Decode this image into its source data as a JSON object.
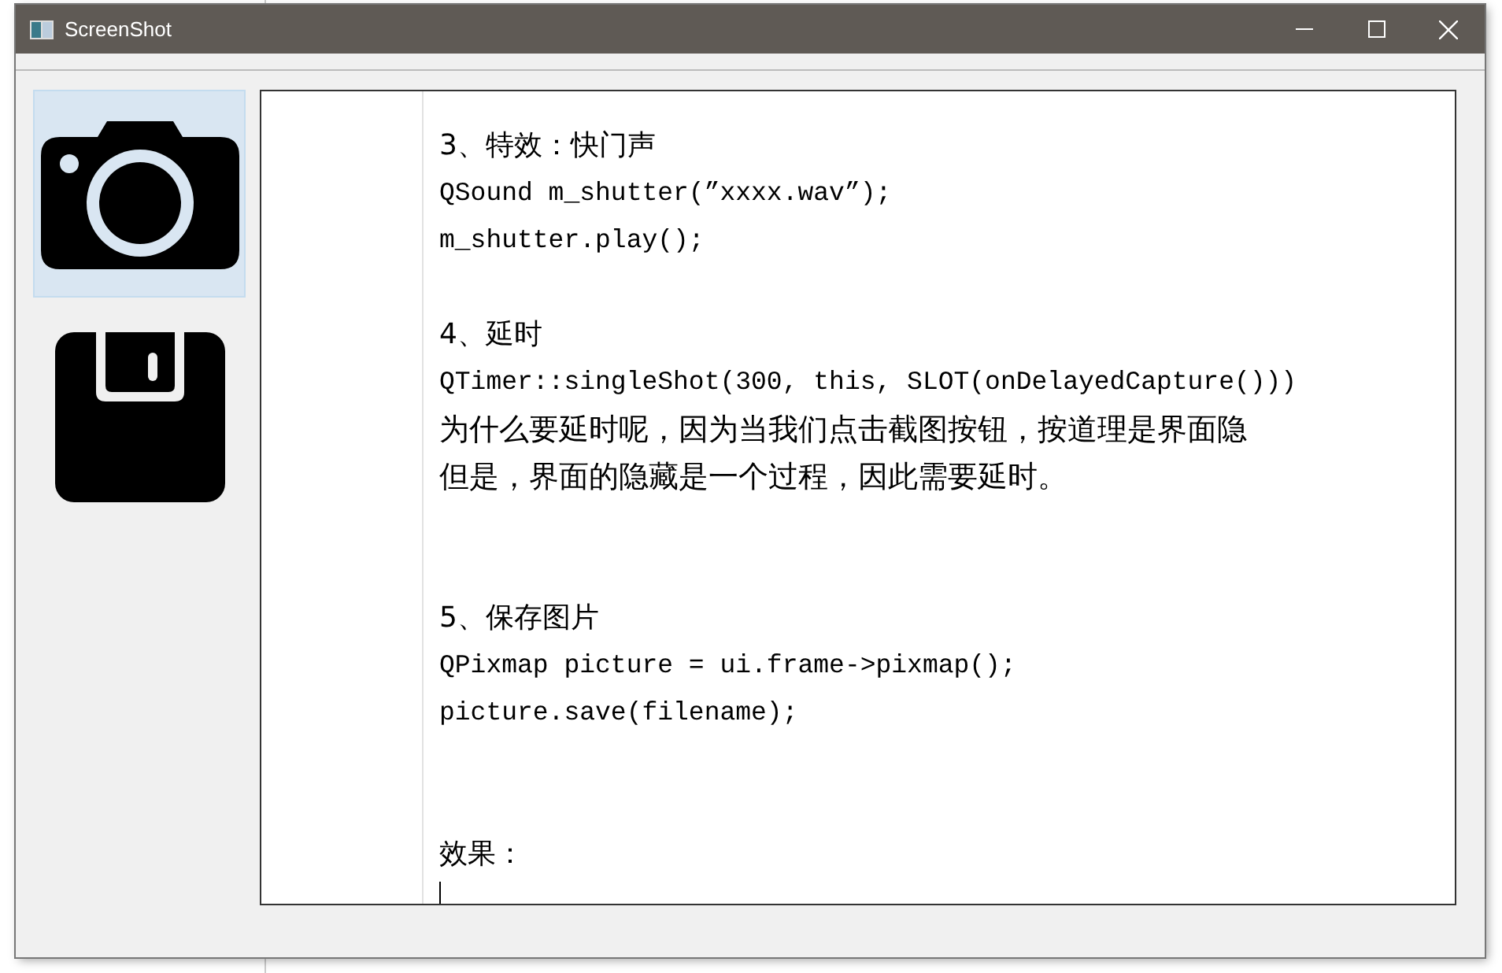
{
  "window": {
    "title": "ScreenShot"
  },
  "tools": [
    {
      "kind": "camera",
      "selected": true
    },
    {
      "kind": "save",
      "selected": false
    }
  ],
  "editor": {
    "caret_visible": true,
    "lines": [
      {
        "kind": "heading",
        "text": "3、特效：快门声"
      },
      {
        "kind": "code",
        "text": "QSound m_shutter(”xxxx.wav”);"
      },
      {
        "kind": "code",
        "text": "m_shutter.play();"
      },
      {
        "kind": "blank"
      },
      {
        "kind": "heading",
        "text": "4、延时"
      },
      {
        "kind": "code",
        "text": "QTimer::singleShot(300, this, SLOT(onDelayedCapture()))"
      },
      {
        "kind": "text",
        "text": "为什么要延时呢，因为当我们点击截图按钮，按道理是界面隐"
      },
      {
        "kind": "text",
        "text": "但是，界面的隐藏是一个过程，因此需要延时。"
      },
      {
        "kind": "blank"
      },
      {
        "kind": "blank"
      },
      {
        "kind": "heading",
        "text": "5、保存图片"
      },
      {
        "kind": "code",
        "text": "QPixmap picture = ui.frame->pixmap();"
      },
      {
        "kind": "code",
        "text": "picture.save(filename);"
      },
      {
        "kind": "blank"
      },
      {
        "kind": "blank"
      },
      {
        "kind": "heading",
        "text": "效果："
      }
    ]
  }
}
